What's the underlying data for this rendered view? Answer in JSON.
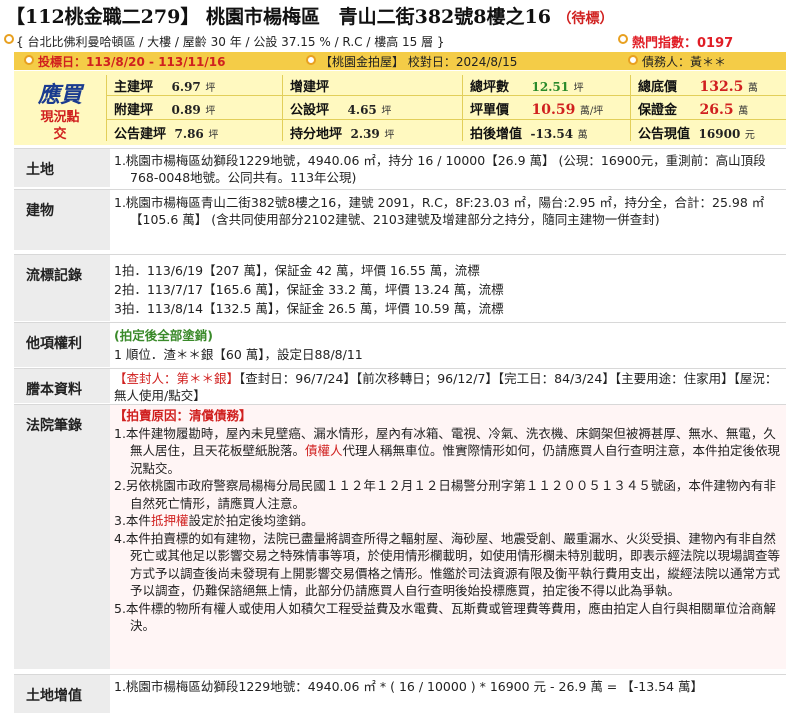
{
  "title": {
    "code": "【112桃金職二279】",
    "district": "桃園市楊梅區",
    "address": "青山二街382號8樓之16",
    "status": "（待標）"
  },
  "addr_info": {
    "text": "{ 台北比佛利曼哈頓區 / 大樓 / 屋齡 30 年 / 公設 37.15 % / R.C / 樓高 15 層 }",
    "hot_label": "熱門指數：0197"
  },
  "info_bar": {
    "dates": "投標日：113/8/20 - 113/11/16",
    "source": "【桃園金拍屋】 校對日：2024/8/15",
    "debtor": "債務人：黃＊＊"
  },
  "yingmai": {
    "big": "應買",
    "sub1": "現況點",
    "sub2": "交"
  },
  "summary": {
    "main_ping_label": "主建坪",
    "main_ping": "6.97",
    "unit_ping": "坪",
    "aux_ping_label": "附建坪",
    "aux_ping": "0.89",
    "common_ping_label": "公告建坪",
    "common_ping": "7.86",
    "add_ping_label": "增建坪",
    "share_ping_label": "公設坪",
    "share_ping": "4.65",
    "land_ping_label": "持分地坪",
    "land_ping": "2.39",
    "total_ping_label": "總坪數",
    "total_ping": "12.51",
    "unit_price_label": "坪單價",
    "unit_price": "10.59",
    "unit_price_unit": "萬/坪",
    "post_label": "拍後增值",
    "post_value": "-13.54",
    "unit_wan": "萬",
    "base_label": "總底價",
    "base_price": "132.5",
    "deposit_label": "保證金",
    "deposit": "26.5",
    "present_label": "公告現值",
    "present_value": "16900",
    "unit_yuan": "元"
  },
  "sections": {
    "land": {
      "label": "土地",
      "text": "1.桃園市楊梅區幼獅段1229地號，4940.06 ㎡，持分 16 / 10000【26.9 萬】 (公現：16900元，重測前：高山頂段768-0048地號。公同共有。113年公現)"
    },
    "building": {
      "label": "建物",
      "text": "1.桃園市楊梅區青山二街382號8樓之16，建號 2091，R.C，8F:23.03 ㎡，陽台:2.95 ㎡，持分全，合計：25.98 ㎡【105.6 萬】 (含共同使用部分2102建號、2103建號及增建部分之持分，隨同主建物一併查封)"
    },
    "history": {
      "label": "流標記錄",
      "l1": "1拍．113/6/19【207 萬】，保証金 42 萬，坪價 16.55 萬，流標",
      "l2": "2拍．113/7/17【165.6 萬】，保証金 33.2 萬，坪價 13.24 萬，流標",
      "l3": "3拍．113/8/14【132.5 萬】，保証金 26.5 萬，坪價 10.59 萬，流標"
    },
    "rights": {
      "label": "他項權利",
      "l1": "(拍定後全部塗銷)",
      "l2": "1 順位．渣＊＊銀【60 萬】，設定日88/8/11"
    },
    "registry": {
      "label": "謄本資料",
      "seize": "【查封人：第＊＊銀】",
      "text": "【查封日：96/7/24】【前次移轉日；96/12/7】【完工日：84/3/24】【主要用途：住家用】【屋況：無人使用/點交】"
    },
    "court": {
      "label": "法院筆錄",
      "reason": "【拍賣原因：清償債務】",
      "n1a": "1.本件建物履勘時，屋內未見壁癌、漏水情形，屋內有冰箱、電視、冷氣、洗衣機、床鋼架但被褥甚厚、無水、無電，久無人居住，且天花板壁紙脫落。",
      "n1b": "債權人",
      "n1c": "代理人稱無車位。惟實際情形如何，仍請應買人自行查明注意，本件拍定後依現況點交。",
      "n2": "2.另依桃園市政府警察局楊梅分局民國１１２年１２月１２日楊警分刑字第１１２００５１３４５號函，本件建物內有非自然死亡情形，請應買人注意。",
      "n3a": "3.本件",
      "n3b": "抵押權",
      "n3c": "設定於拍定後均塗銷。",
      "n4": "4.本件拍賣標的如有建物，法院已盡量將調查所得之輻射屋、海砂屋、地震受創、嚴重漏水、火災受損、建物內有非自然死亡或其他足以影響交易之特殊情事等項，於使用情形欄載明，如使用情形欄未特別載明，即表示經法院以現場調查等方式予以調查後尚未發現有上開影響交易價格之情形。惟鑑於司法資源有限及衡平執行費用支出，縱經法院以通常方式予以調查，仍難保諮絕無上情，此部分仍請應買人自行查明後始投標應買，拍定後不得以此為爭執。",
      "n5": "5.本件標的物所有權人或使用人如積欠工程受益費及水電費、瓦斯費或管理費等費用，應由拍定人自行與相關單位洽商解決。"
    },
    "appreciation": {
      "label": "土地增值",
      "text": "1.桃園市楊梅區幼獅段1229地號：4940.06 ㎡ * ( 16 / 10000 ) * 16900 元 - 26.9 萬 = 【-13.54 萬】"
    }
  },
  "colors": {
    "info_bar": "#f4cc47",
    "summary_bg": "#fff9c0",
    "red": "#d0201f"
  }
}
